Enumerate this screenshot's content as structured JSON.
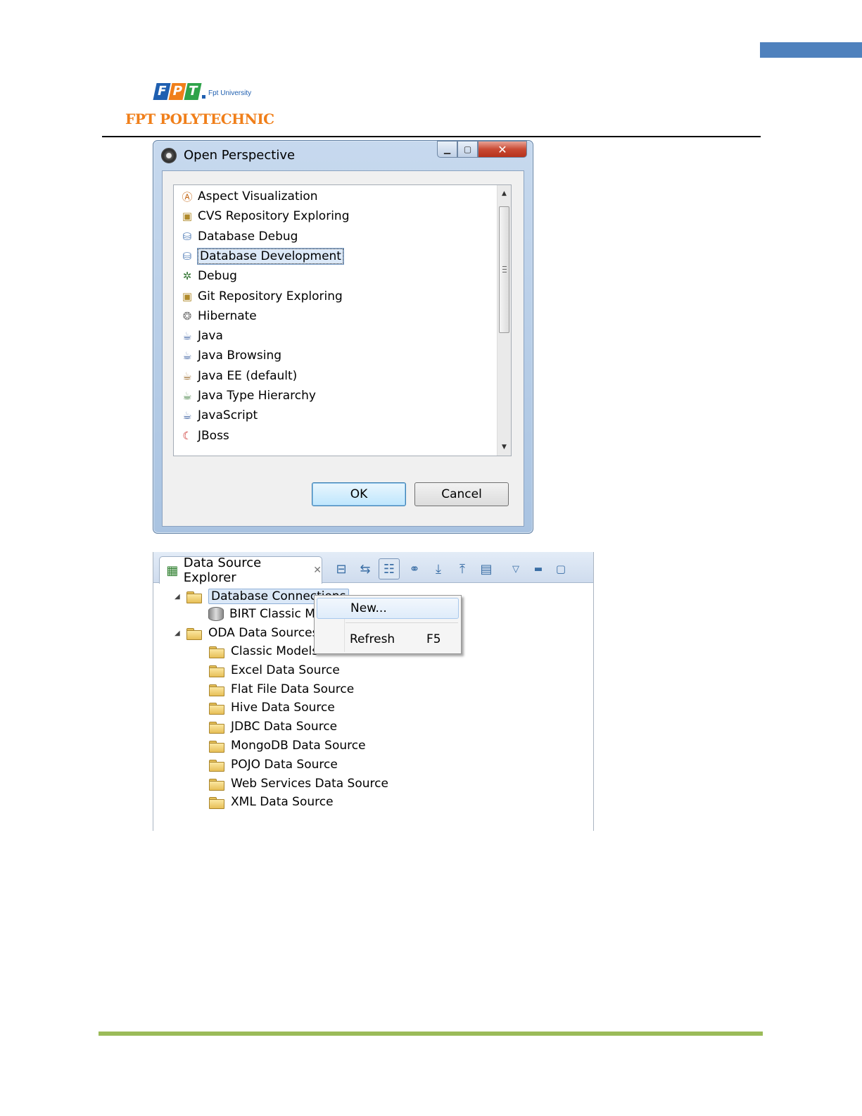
{
  "logo": {
    "letters": [
      "F",
      "P",
      "T"
    ],
    "university": "Fpt University",
    "name": "FPT POLYTECHNIC"
  },
  "colors": {
    "corner_tab": "#4f81bd",
    "footer_rule": "#9bbb59",
    "logo_orange": "#f07f1a",
    "logo_blue": "#1f5fb0"
  },
  "dialog": {
    "title": "Open Perspective",
    "icon": "eclipse-perspective-icon",
    "items": [
      {
        "label": "Aspect Visualization",
        "icon": "aspect-icon"
      },
      {
        "label": "CVS Repository Exploring",
        "icon": "cvs-icon"
      },
      {
        "label": "Database Debug",
        "icon": "database-debug-icon"
      },
      {
        "label": "Database Development",
        "icon": "database-dev-icon"
      },
      {
        "label": "Debug",
        "icon": "bug-icon"
      },
      {
        "label": "Git Repository Exploring",
        "icon": "git-icon"
      },
      {
        "label": "Hibernate",
        "icon": "hibernate-icon"
      },
      {
        "label": "Java",
        "icon": "java-icon"
      },
      {
        "label": "Java Browsing",
        "icon": "java-browsing-icon"
      },
      {
        "label": "Java EE (default)",
        "icon": "java-ee-icon"
      },
      {
        "label": "Java Type Hierarchy",
        "icon": "type-hierarchy-icon"
      },
      {
        "label": "JavaScript",
        "icon": "javascript-icon"
      },
      {
        "label": "JBoss",
        "icon": "jboss-icon"
      }
    ],
    "selected_index": 3,
    "ok_label": "OK",
    "cancel_label": "Cancel"
  },
  "explorer": {
    "tab_label": "Data Source Explorer",
    "tree": {
      "database_connections": "Database Connections",
      "birt": "BIRT Classic Mo",
      "oda": "ODA Data Sources",
      "oda_children": [
        "Classic Models",
        "Excel Data Source",
        "Flat File Data Source",
        "Hive Data Source",
        "JDBC Data Source",
        "MongoDB Data Source",
        "POJO Data Source",
        "Web Services Data Source",
        "XML Data Source"
      ]
    },
    "context_menu": {
      "new_label": "New...",
      "refresh_label": "Refresh",
      "refresh_shortcut": "F5"
    }
  }
}
